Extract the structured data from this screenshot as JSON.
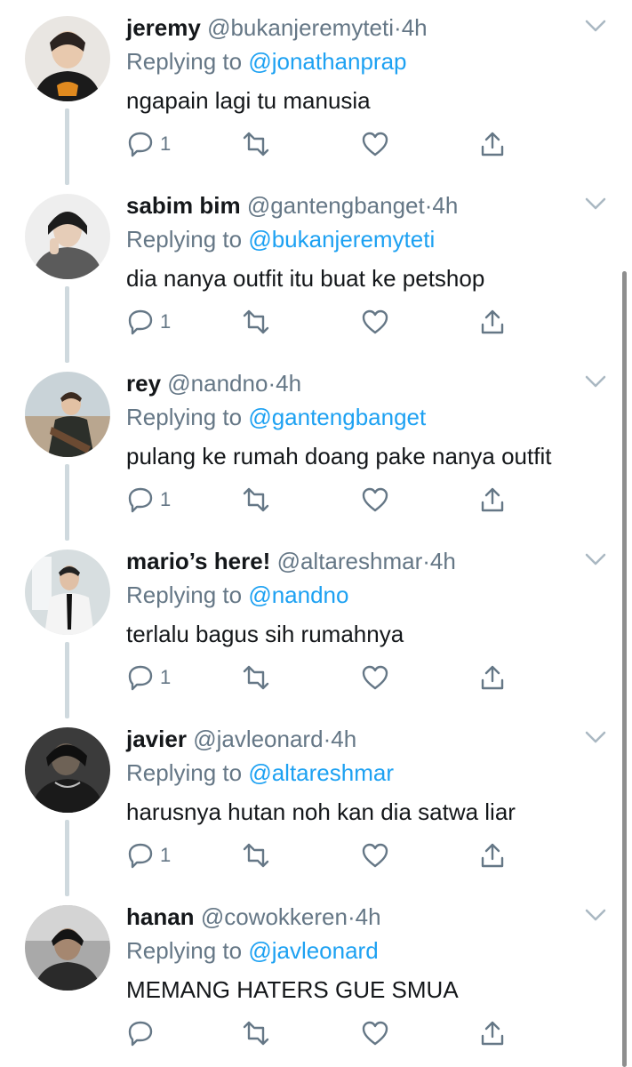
{
  "tweets": [
    {
      "name": "jeremy",
      "handle": "@bukanjeremyteti",
      "time": "4h",
      "reply_prefix": "Replying to",
      "reply_to": "@jonathanprap",
      "text": "ngapain lagi tu manusia",
      "reply_count": "1"
    },
    {
      "name": "sabim bim",
      "handle": "@gantengbanget",
      "time": "4h",
      "reply_prefix": "Replying to",
      "reply_to": "@bukanjeremyteti",
      "text": "dia nanya outfit itu buat ke petshop",
      "reply_count": "1"
    },
    {
      "name": "rey",
      "handle": "@nandno",
      "time": "4h",
      "reply_prefix": "Replying to",
      "reply_to": "@gantengbanget",
      "text": "pulang ke rumah doang pake nanya outfit",
      "reply_count": "1"
    },
    {
      "name": "mario’s here!",
      "handle": "@altareshmar",
      "time": "4h",
      "reply_prefix": "Replying to",
      "reply_to": "@nandno",
      "text": "terlalu bagus sih rumahnya",
      "reply_count": "1"
    },
    {
      "name": "javier",
      "handle": "@javleonard",
      "time": "4h",
      "reply_prefix": "Replying to",
      "reply_to": "@altareshmar",
      "text": "harusnya hutan noh kan dia satwa liar",
      "reply_count": "1"
    },
    {
      "name": "hanan",
      "handle": "@cowokkeren",
      "time": "4h",
      "reply_prefix": "Replying to",
      "reply_to": "@javleonard",
      "text": "MEMANG HATERS GUE SMUA",
      "reply_count": ""
    }
  ],
  "separator": "·",
  "colors": {
    "accent": "#1da1f2",
    "secondary_text": "#657786",
    "primary_text": "#14171a",
    "thread_line": "#cfd9de"
  },
  "icons": [
    "reply-icon",
    "retweet-icon",
    "like-icon",
    "share-icon",
    "chevron-down-icon"
  ]
}
